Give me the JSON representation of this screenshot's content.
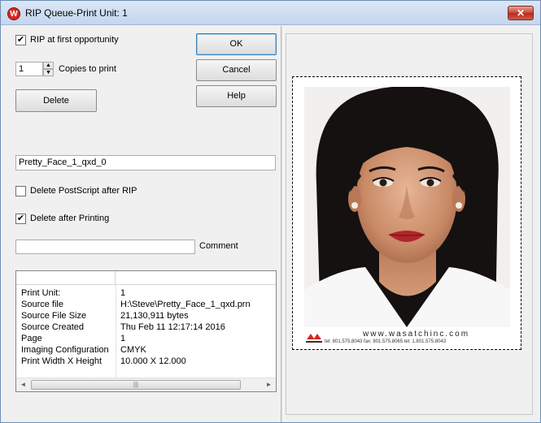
{
  "window": {
    "title": "RIP Queue-Print Unit: 1",
    "app_icon_letter": "W",
    "close_glyph": "✕"
  },
  "options": {
    "rip_first_opportunity": {
      "label": "RIP at first opportunity",
      "checked": true
    },
    "copies": {
      "value": "1",
      "label": "Copies to print"
    },
    "delete_button": "Delete",
    "job_name": "Pretty_Face_1_qxd_0",
    "delete_postscript": {
      "label": "Delete PostScript after RIP",
      "checked": false
    },
    "delete_after_printing": {
      "label": "Delete after Printing",
      "checked": true
    },
    "comment": {
      "value": "",
      "label": "Comment"
    }
  },
  "buttons": {
    "ok": "OK",
    "cancel": "Cancel",
    "help": "Help"
  },
  "info_table": {
    "rows": [
      {
        "key": "Print Unit:",
        "value": "1"
      },
      {
        "key": "Source file",
        "value": "H:\\Steve\\Pretty_Face_1_qxd.prn"
      },
      {
        "key": "Source File Size",
        "value": "21,130,911 bytes"
      },
      {
        "key": "Source Created",
        "value": "Thu Feb 11 12:17:14 2016"
      },
      {
        "key": "Page",
        "value": "1"
      },
      {
        "key": "Imaging Configuration",
        "value": "CMYK"
      },
      {
        "key": "Print Width X Height",
        "value": "10.000 X 12.000"
      }
    ],
    "scroll_left": "◄",
    "scroll_right": "►",
    "scroll_grip": "|||"
  },
  "preview": {
    "caption_url": "www.wasatchinc.com",
    "caption_small": "tel: 801.575.8043   fax: 801.575.8065   tel: 1.801.575.8043",
    "colors": {
      "logo_red": "#d8261d"
    }
  },
  "icons": {
    "check": "✔",
    "spin_up": "▲",
    "spin_down": "▼"
  }
}
